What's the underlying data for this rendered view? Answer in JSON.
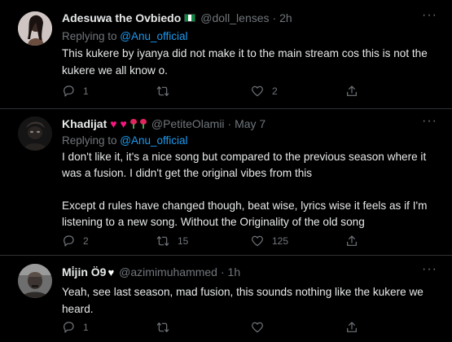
{
  "colors": {
    "background": "#000000",
    "accent": "#1d9bf0",
    "muted": "#71767b",
    "text": "#e7e9ea",
    "divider": "#2f3336"
  },
  "tweets": [
    {
      "name": "Adesuwa the Ovbiedo",
      "name_suffix_icon": "nigeria-flag-icon",
      "handle": "@doll_lenses",
      "time": "· 2h",
      "replying_prefix": "Replying to ",
      "replying_to": "@Anu_official",
      "paragraphs": [
        "This  kukere by iyanya did not make it to the main stream cos this is not the kukere we all know o."
      ],
      "actions": {
        "reply": "1",
        "retweet": "",
        "like": "2"
      }
    },
    {
      "name": "Khadijat",
      "name_suffix_icon": "hearts-and-roses-emoji",
      "handle": "@PetiteOlamii",
      "time": "· May 7",
      "replying_prefix": "Replying to ",
      "replying_to": "@Anu_official",
      "paragraphs": [
        "I don't like it, it's a nice song but compared to the previous season where it was a fusion. I didn't get the original vibes from this",
        "Except d rules have changed though, beat wise, lyrics wise it feels as if I'm listening to a new song. Without the Originality of the old song"
      ],
      "actions": {
        "reply": "2",
        "retweet": "15",
        "like": "125"
      }
    },
    {
      "name": "Mi̇jin Ö9",
      "name_suffix_icon": "white-heart-emoji",
      "handle": "@azimimuhammed",
      "time": "· 1h",
      "replying_prefix": "",
      "replying_to": "",
      "paragraphs": [
        "Yeah, see last season, mad fusion, this sounds nothing like the kukere we heard."
      ],
      "actions": {
        "reply": "1",
        "retweet": "",
        "like": ""
      }
    }
  ]
}
